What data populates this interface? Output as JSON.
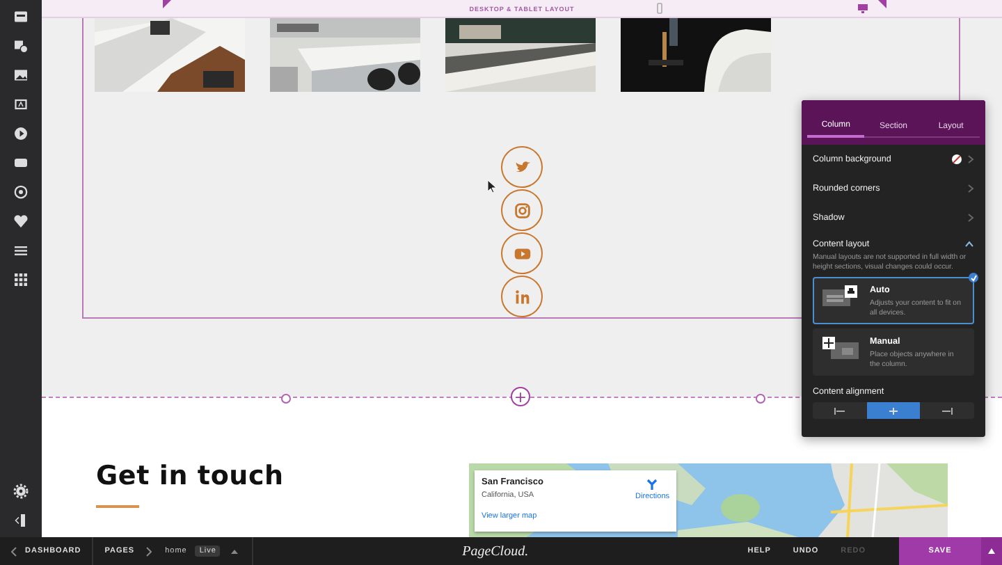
{
  "topbar": {
    "label": "DESKTOP & TABLET LAYOUT",
    "devices": [
      {
        "kind": "phone",
        "selected": false
      },
      {
        "kind": "desktop",
        "selected": true
      }
    ]
  },
  "social": [
    {
      "kind": "twitter"
    },
    {
      "kind": "instagram"
    },
    {
      "kind": "youtube"
    },
    {
      "kind": "linkedin"
    }
  ],
  "panel": {
    "tabs": [
      {
        "label": "Column",
        "selected": true
      },
      {
        "label": "Section",
        "selected": false
      },
      {
        "label": "Layout",
        "selected": false
      }
    ],
    "rows": [
      {
        "label": "Column background",
        "kind": "color"
      },
      {
        "label": "Rounded corners",
        "kind": "arrow"
      },
      {
        "label": "Shadow",
        "kind": "arrow"
      }
    ],
    "content_layout": {
      "title": "Content layout",
      "expanded": true,
      "note": "Manual layouts are not supported in full width or height sections, visual changes could occur.",
      "options": [
        {
          "kind": "auto",
          "title": "Auto",
          "description": "Adjusts your content to fit on all devices.",
          "selected": true
        },
        {
          "kind": "manual",
          "title": "Manual",
          "description": "Place objects anywhere in the column.",
          "selected": false
        }
      ]
    },
    "alignment": {
      "title": "Content alignment",
      "options": [
        {
          "kind": "left",
          "selected": false
        },
        {
          "kind": "center",
          "selected": true
        },
        {
          "kind": "right",
          "selected": false
        }
      ]
    }
  },
  "add_section": "+",
  "contact": {
    "heading": "Get in touch",
    "map": {
      "place": "San Francisco",
      "region": "California, USA",
      "directions": "Directions",
      "link": "View larger map"
    }
  },
  "bottom_bar": {
    "dashboard": "DASHBOARD",
    "pages": "PAGES",
    "page": "home",
    "status": "Live",
    "logo": "PageCloud.",
    "actions": [
      {
        "label": "HELP",
        "disabled": false
      },
      {
        "label": "UNDO",
        "disabled": false
      },
      {
        "label": "REDO",
        "disabled": true
      }
    ],
    "save": "SAVE"
  }
}
